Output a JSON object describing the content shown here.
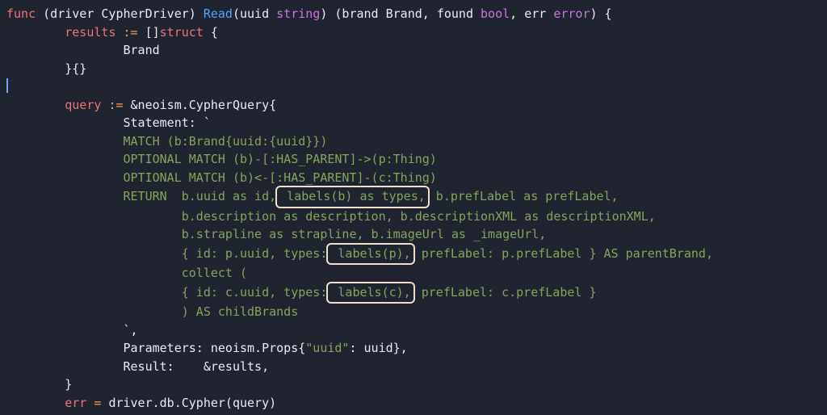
{
  "code": {
    "l1": {
      "func": "func",
      "rcv_open": "(driver CypherDriver)",
      "fn": "Read",
      "params": "(uuid ",
      "ty1": "string",
      "params2": ") (brand Brand, found ",
      "ty2": "bool",
      "params3": ", err ",
      "ty3": "error",
      "params4": ") {"
    },
    "l2": {
      "a": "results ",
      "op": ":=",
      "b": " []",
      "kw": "struct",
      "c": " {"
    },
    "l3": "Brand",
    "l4": "}{}",
    "l5_cursor": "",
    "l6": {
      "a": "query ",
      "op": ":=",
      "b": " &neoism.CypherQuery{"
    },
    "l7": "Statement: `",
    "l8": "MATCH (b:Brand{uuid:{uuid}})",
    "l9": "OPTIONAL MATCH (b)-[:HAS_PARENT]->(p:Thing)",
    "l10": "OPTIONAL MATCH (b)<-[:HAS_PARENT]-(c:Thing)",
    "l11a": "RETURN  b.uuid as id,",
    "l11box": " labels(b) as types,",
    "l11b": " b.prefLabel as prefLabel,",
    "l12": "b.description as description, b.descriptionXML as descriptionXML,",
    "l13": "b.strapline as strapline, b.imageUrl as _imageUrl,",
    "l14a": "{ id: p.uuid, types:",
    "l14box": " labels(p),",
    "l14b": " prefLabel: p.prefLabel } AS parentBrand,",
    "l15": "collect (",
    "l16a": "{ id: c.uuid, types:",
    "l16box": " labels(c),",
    "l16b": " prefLabel: c.prefLabel }",
    "l17": ") AS childBrands",
    "l18": "`,",
    "l19": {
      "a": "Parameters: neoism.Props{",
      "s": "\"uuid\"",
      "b": ": uuid},"
    },
    "l20": "Result:    &results,",
    "l21": "}",
    "l22": {
      "a": "err",
      "op": " = ",
      "b": "driver.db.Cypher(query)"
    }
  },
  "highlight_boxes": [
    "labels(b) as types",
    "labels(p)",
    "labels(c)"
  ]
}
